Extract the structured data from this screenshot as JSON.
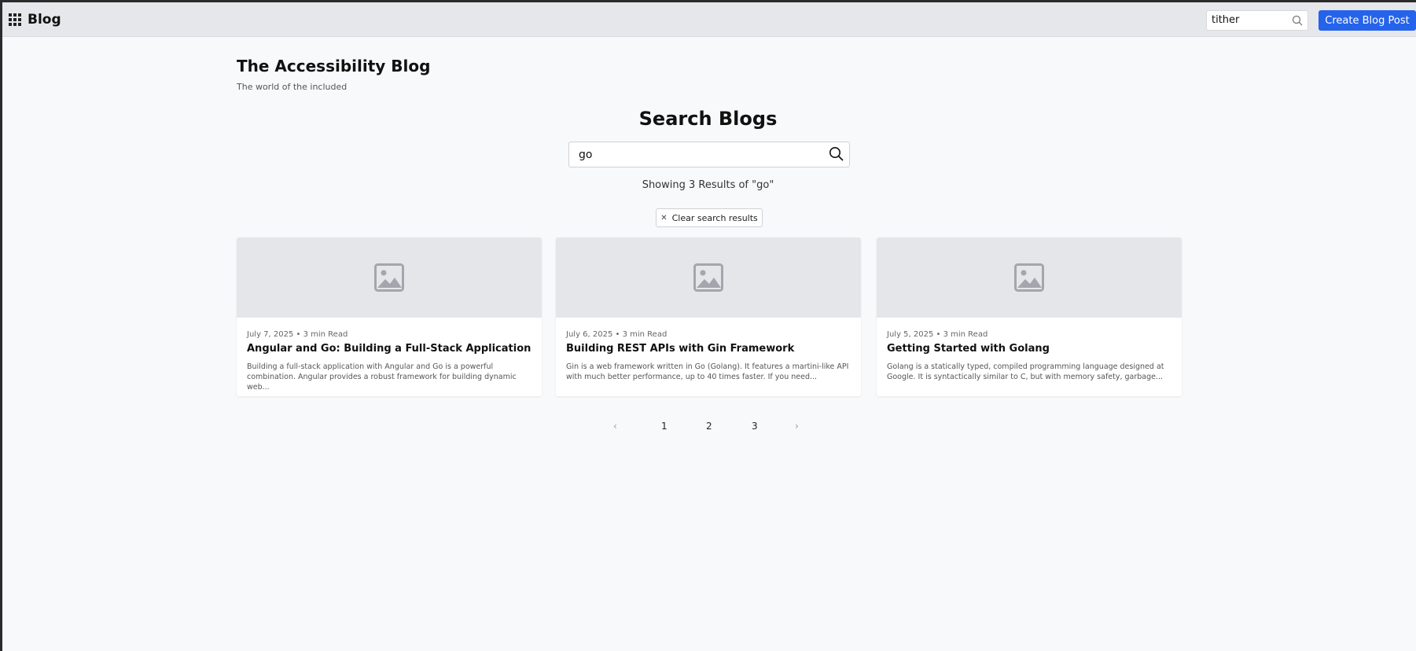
{
  "header": {
    "brand": "Blog",
    "search_value": "tither",
    "create_label": "Create Blog Post",
    "accent_color": "#2563eb"
  },
  "blog": {
    "title": "The Accessibility Blog",
    "subtitle": "The world of the included"
  },
  "search": {
    "heading": "Search Blogs",
    "query": "go",
    "results_text": "Showing 3 Results of \"go\"",
    "clear_label": "Clear search results"
  },
  "posts": [
    {
      "meta": "July 7, 2025 • 3 min Read",
      "title": "Angular and Go: Building a Full-Stack Application",
      "excerpt": "Building a full-stack application with Angular and Go is a powerful combination. Angular provides a robust framework for building dynamic web..."
    },
    {
      "meta": "July 6, 2025 • 3 min Read",
      "title": "Building REST APIs with Gin Framework",
      "excerpt": "Gin is a web framework written in Go (Golang). It features a martini-like API with much better performance, up to 40 times faster. If you need..."
    },
    {
      "meta": "July 5, 2025 • 3 min Read",
      "title": "Getting Started with Golang",
      "excerpt": "Golang is a statically typed, compiled programming language designed at Google. It is syntactically similar to C, but with memory safety, garbage..."
    }
  ],
  "pagination": {
    "prev": "‹",
    "next": "›",
    "pages": [
      "1",
      "2",
      "3"
    ]
  },
  "icons": {
    "apps": "apps-grid-icon",
    "search": "search-icon",
    "image": "image-placeholder-icon",
    "close": "close-icon"
  }
}
